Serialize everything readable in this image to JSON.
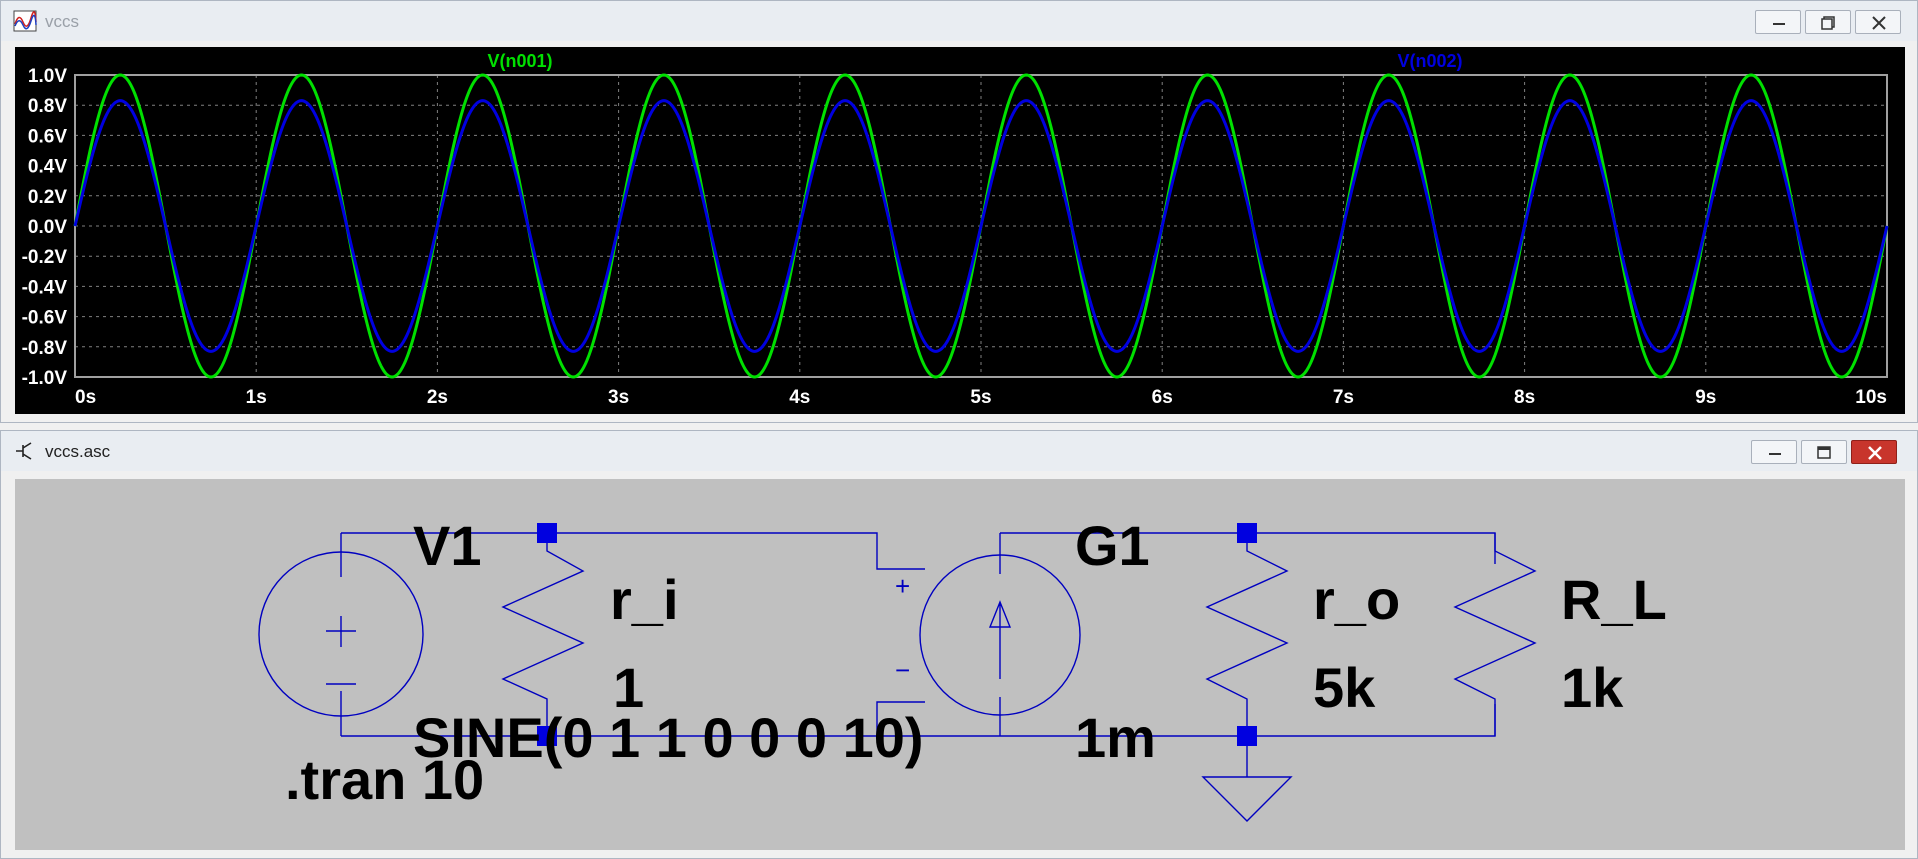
{
  "plot_window": {
    "title": "vccs",
    "icon": "waveform-icon",
    "controls": [
      "minimize-icon",
      "maximize-icon",
      "close-icon"
    ]
  },
  "schematic_window": {
    "title": "vccs.asc",
    "icon": "transistor-icon",
    "controls": [
      "minimize-icon",
      "maximize-icon",
      "close-icon"
    ]
  },
  "chart_data": {
    "type": "line",
    "x_range": [
      0,
      10
    ],
    "ylim": [
      -1.0,
      1.0
    ],
    "x_ticks": [
      "0s",
      "1s",
      "2s",
      "3s",
      "4s",
      "5s",
      "6s",
      "7s",
      "8s",
      "9s",
      "10s"
    ],
    "y_ticks": [
      "1.0V",
      "0.8V",
      "0.6V",
      "0.4V",
      "0.2V",
      "0.0V",
      "-0.2V",
      "-0.4V",
      "-0.6V",
      "-0.8V",
      "-1.0V"
    ],
    "grid": true,
    "background": "#000000",
    "series": [
      {
        "name": "V(n001)",
        "color": "#00e000",
        "waveform": "sine",
        "amplitude": 1.0,
        "frequency_hz": 1
      },
      {
        "name": "V(n002)",
        "color": "#0000e0",
        "waveform": "sine",
        "amplitude": 0.83,
        "frequency_hz": 1
      }
    ]
  },
  "schematic": {
    "background": "#c0c0c0",
    "wire_color": "#0000c0",
    "v1_name": "V1",
    "v1_value": "SINE(0 1 1 0 0 0 10)",
    "ri_name": "r_i",
    "ri_value": "1",
    "g1_name": "G1",
    "g1_value": "1m",
    "ro_name": "r_o",
    "ro_value": "5k",
    "rl_name": "R_L",
    "rl_value": "1k",
    "directive": ".tran 10",
    "plus_sign": "+",
    "minus_sign": "−"
  }
}
